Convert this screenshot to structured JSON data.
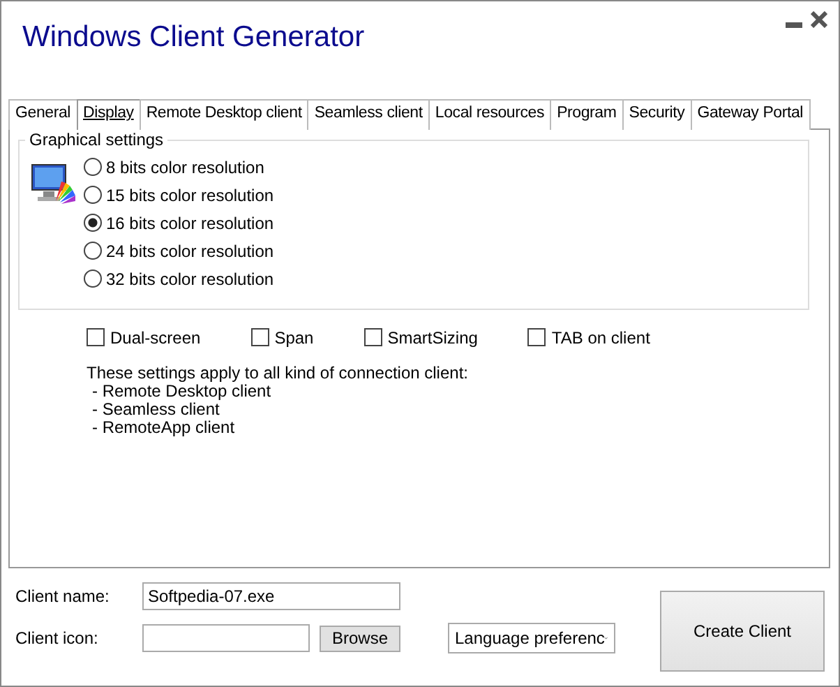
{
  "window": {
    "title": "Windows Client Generator"
  },
  "tabs": [
    {
      "label": "General",
      "selected": false
    },
    {
      "label": "Display",
      "selected": true
    },
    {
      "label": "Remote Desktop client",
      "selected": false
    },
    {
      "label": "Seamless client",
      "selected": false
    },
    {
      "label": "Local resources",
      "selected": false
    },
    {
      "label": "Program",
      "selected": false
    },
    {
      "label": "Security",
      "selected": false
    },
    {
      "label": "Gateway Portal",
      "selected": false
    }
  ],
  "graphical_settings": {
    "title": "Graphical settings",
    "options": [
      {
        "label": "8 bits color resolution",
        "selected": false
      },
      {
        "label": "15 bits color resolution",
        "selected": false
      },
      {
        "label": "16 bits color resolution",
        "selected": true
      },
      {
        "label": "24 bits color resolution",
        "selected": false
      },
      {
        "label": "32 bits color resolution",
        "selected": false
      }
    ]
  },
  "checkboxes": [
    {
      "label": "Dual-screen",
      "checked": false
    },
    {
      "label": "Span",
      "checked": false
    },
    {
      "label": "SmartSizing",
      "checked": false
    },
    {
      "label": "TAB on client",
      "checked": false
    }
  ],
  "note": {
    "heading": "These settings apply to all kind of connection client:",
    "items": [
      "- Remote Desktop client",
      "- Seamless client",
      "- RemoteApp client"
    ]
  },
  "client_name": {
    "label": "Client name:",
    "value": "Softpedia-07.exe"
  },
  "client_icon": {
    "label": "Client icon:",
    "button": "Browse"
  },
  "language": {
    "value": "Language preferenc"
  },
  "create_button": "Create Client"
}
